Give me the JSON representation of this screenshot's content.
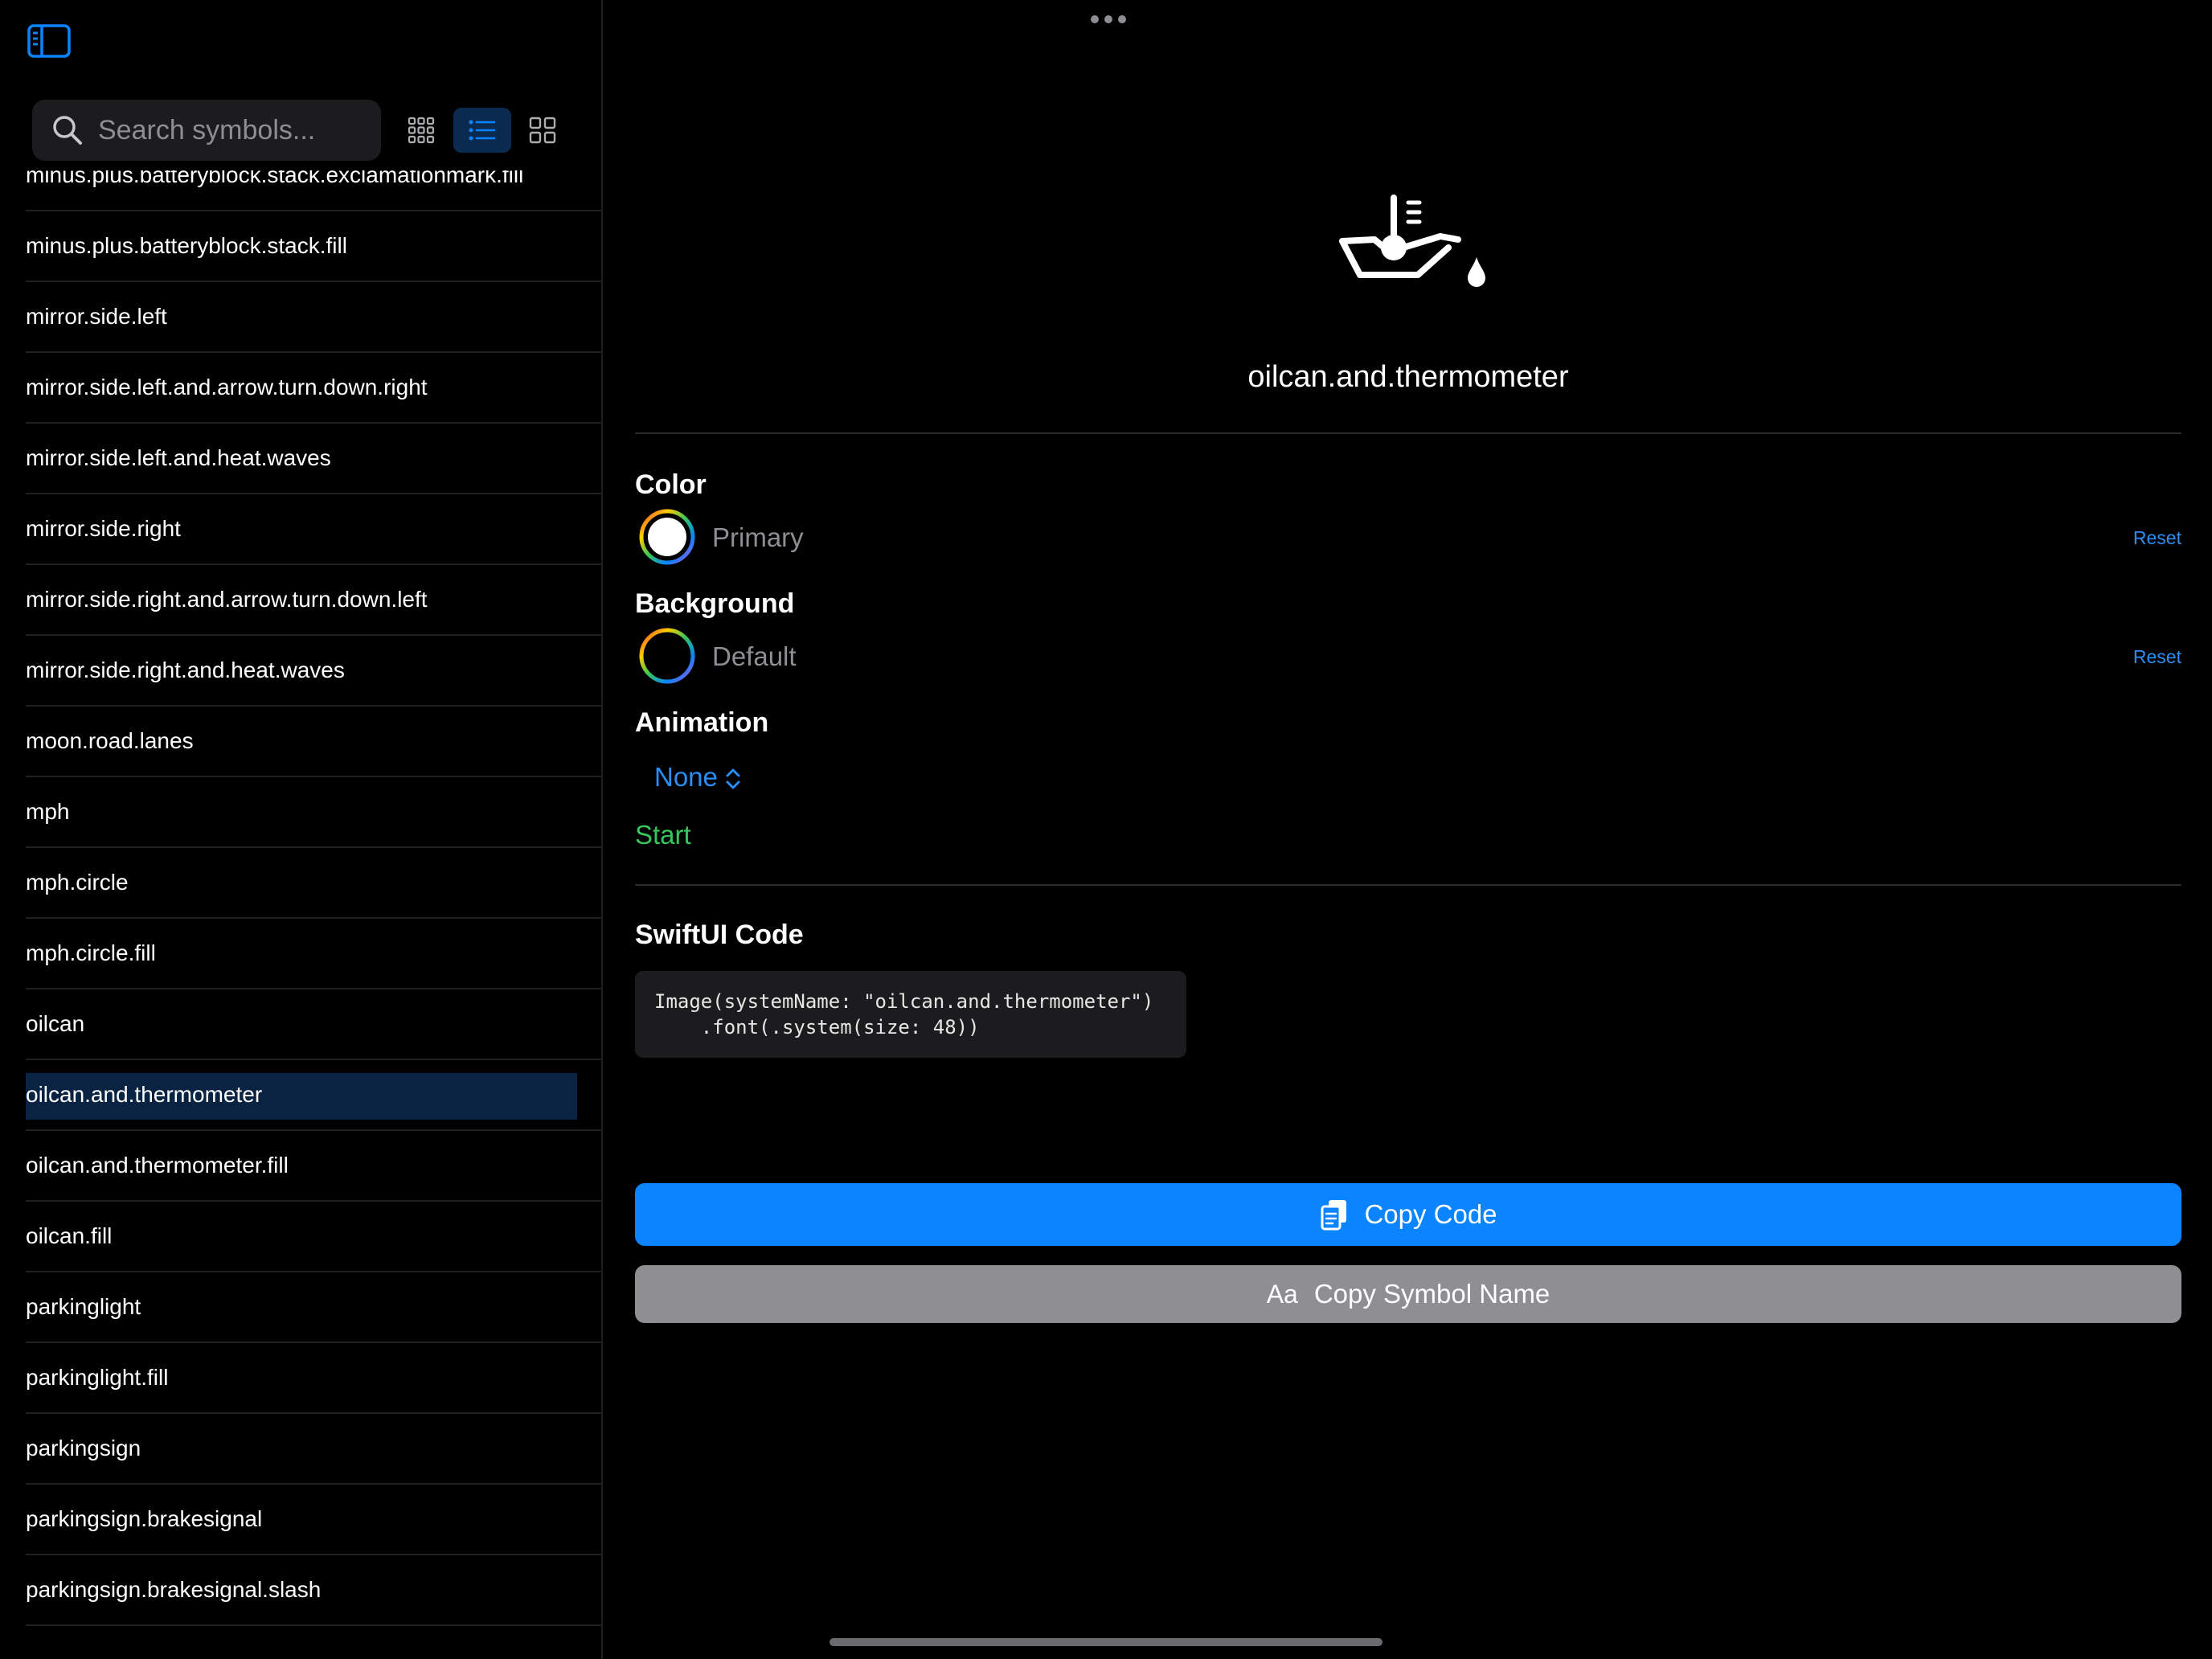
{
  "search": {
    "placeholder": "Search symbols..."
  },
  "symbols": [
    "minus.plus.batteryblock.stack.exclamationmark.fill",
    "minus.plus.batteryblock.stack.fill",
    "mirror.side.left",
    "mirror.side.left.and.arrow.turn.down.right",
    "mirror.side.left.and.heat.waves",
    "mirror.side.right",
    "mirror.side.right.and.arrow.turn.down.left",
    "mirror.side.right.and.heat.waves",
    "moon.road.lanes",
    "mph",
    "mph.circle",
    "mph.circle.fill",
    "oilcan",
    "oilcan.and.thermometer",
    "oilcan.and.thermometer.fill",
    "oilcan.fill",
    "parkinglight",
    "parkinglight.fill",
    "parkingsign",
    "parkingsign.brakesignal",
    "parkingsign.brakesignal.slash"
  ],
  "selected_symbol": "oilcan.and.thermometer",
  "detail": {
    "title": "oilcan.and.thermometer",
    "color": {
      "label": "Color",
      "value": "Primary",
      "reset": "Reset"
    },
    "background": {
      "label": "Background",
      "value": "Default",
      "reset": "Reset"
    },
    "animation": {
      "label": "Animation",
      "value": "None",
      "start": "Start"
    },
    "code": {
      "label": "SwiftUI Code",
      "line1": "Image(systemName: \"oilcan.and.thermometer\")",
      "line2": "    .font(.system(size: 48))"
    },
    "copy_code": "Copy Code",
    "copy_name_prefix": "Aa",
    "copy_name": "Copy Symbol Name"
  },
  "colors": {
    "accent": "#0a84ff",
    "start": "#3ac55c",
    "secondary_button": "#8e8e93",
    "selection": "#0b2342"
  },
  "icons": [
    "sidebar-icon",
    "search-icon",
    "grid-small-icon",
    "list-icon",
    "grid-large-icon",
    "more-icon",
    "oilcan-thermometer-icon",
    "chevron-updown-icon",
    "copy-icon"
  ]
}
